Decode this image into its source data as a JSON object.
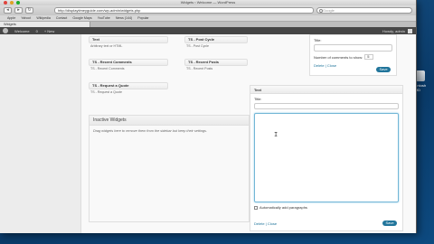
{
  "browser": {
    "window_title": "Widgets ‹ Welcome — WordPress",
    "url": "http://displaytimeyguide.com/wp-admin/widgets.php",
    "search_placeholder": "Google",
    "bookmarks": [
      "Apple",
      "Yahoo!",
      "Wikipedia",
      "Contact",
      "Google Maps",
      "YouTube",
      "News (144)",
      "Popular"
    ],
    "tab_label": "Widgets"
  },
  "adminbar": {
    "site_name": "Welcome",
    "comments_count": "0",
    "new_label": "+ New",
    "howdy": "Howdy, admin"
  },
  "widgets": [
    {
      "title": "Text",
      "desc": "Arbitrary text or HTML"
    },
    {
      "title": "TS - Post Cycle",
      "desc": "TS - Post Cycle"
    },
    {
      "title": "TS - Recent Comments",
      "desc": "TS - Recent Comments"
    },
    {
      "title": "TS - Recent Posts",
      "desc": "TS - Recent Posts"
    },
    {
      "title": "TS - Request a Quote",
      "desc": "TS - Request a Quote"
    }
  ],
  "inactive": {
    "title": "Inactive Widgets",
    "desc": "Drag widgets here to remove them from the sidebar but keep their settings."
  },
  "side_widget": {
    "title_label": "Title:",
    "number_label": "Number of comments to show:",
    "number_value": "5",
    "delete_close": "Delete | Close",
    "save_label": "Save"
  },
  "text_widget": {
    "header": "Text",
    "title_label": "Title:",
    "autop_label": "Automatically add paragraphs",
    "delete_close": "Delete | Close",
    "save_label": "Save"
  },
  "desktop_icon_label": "Macintosh HD"
}
